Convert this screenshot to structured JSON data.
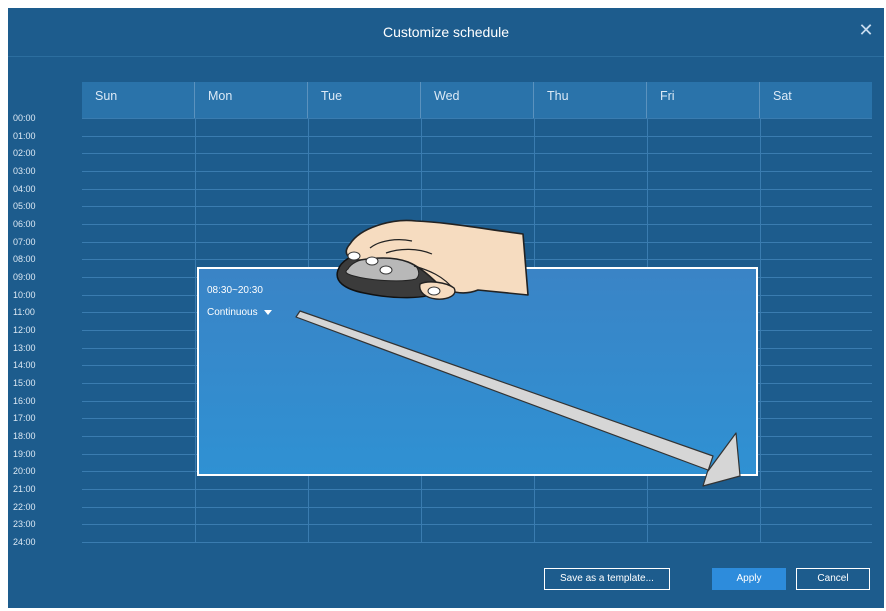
{
  "dialog": {
    "title": "Customize schedule",
    "close_icon": "close-icon"
  },
  "days": [
    "Sun",
    "Mon",
    "Tue",
    "Wed",
    "Thu",
    "Fri",
    "Sat"
  ],
  "hours": [
    "00:00",
    "01:00",
    "02:00",
    "03:00",
    "04:00",
    "05:00",
    "06:00",
    "07:00",
    "08:00",
    "09:00",
    "10:00",
    "11:00",
    "12:00",
    "13:00",
    "14:00",
    "15:00",
    "16:00",
    "17:00",
    "18:00",
    "19:00",
    "20:00",
    "21:00",
    "22:00",
    "23:00",
    "24:00"
  ],
  "selection": {
    "time_range": "08:30~20:30",
    "mode": "Continuous"
  },
  "buttons": {
    "save_template": "Save as a template...",
    "apply": "Apply",
    "cancel": "Cancel"
  },
  "colors": {
    "background": "#1d5c8d",
    "header": "#2a73aa",
    "selection": "#2f8ad0",
    "primary_button": "#2d8cdc"
  },
  "annotation_icons": [
    "hand-mouse-icon",
    "drag-arrow-icon"
  ]
}
